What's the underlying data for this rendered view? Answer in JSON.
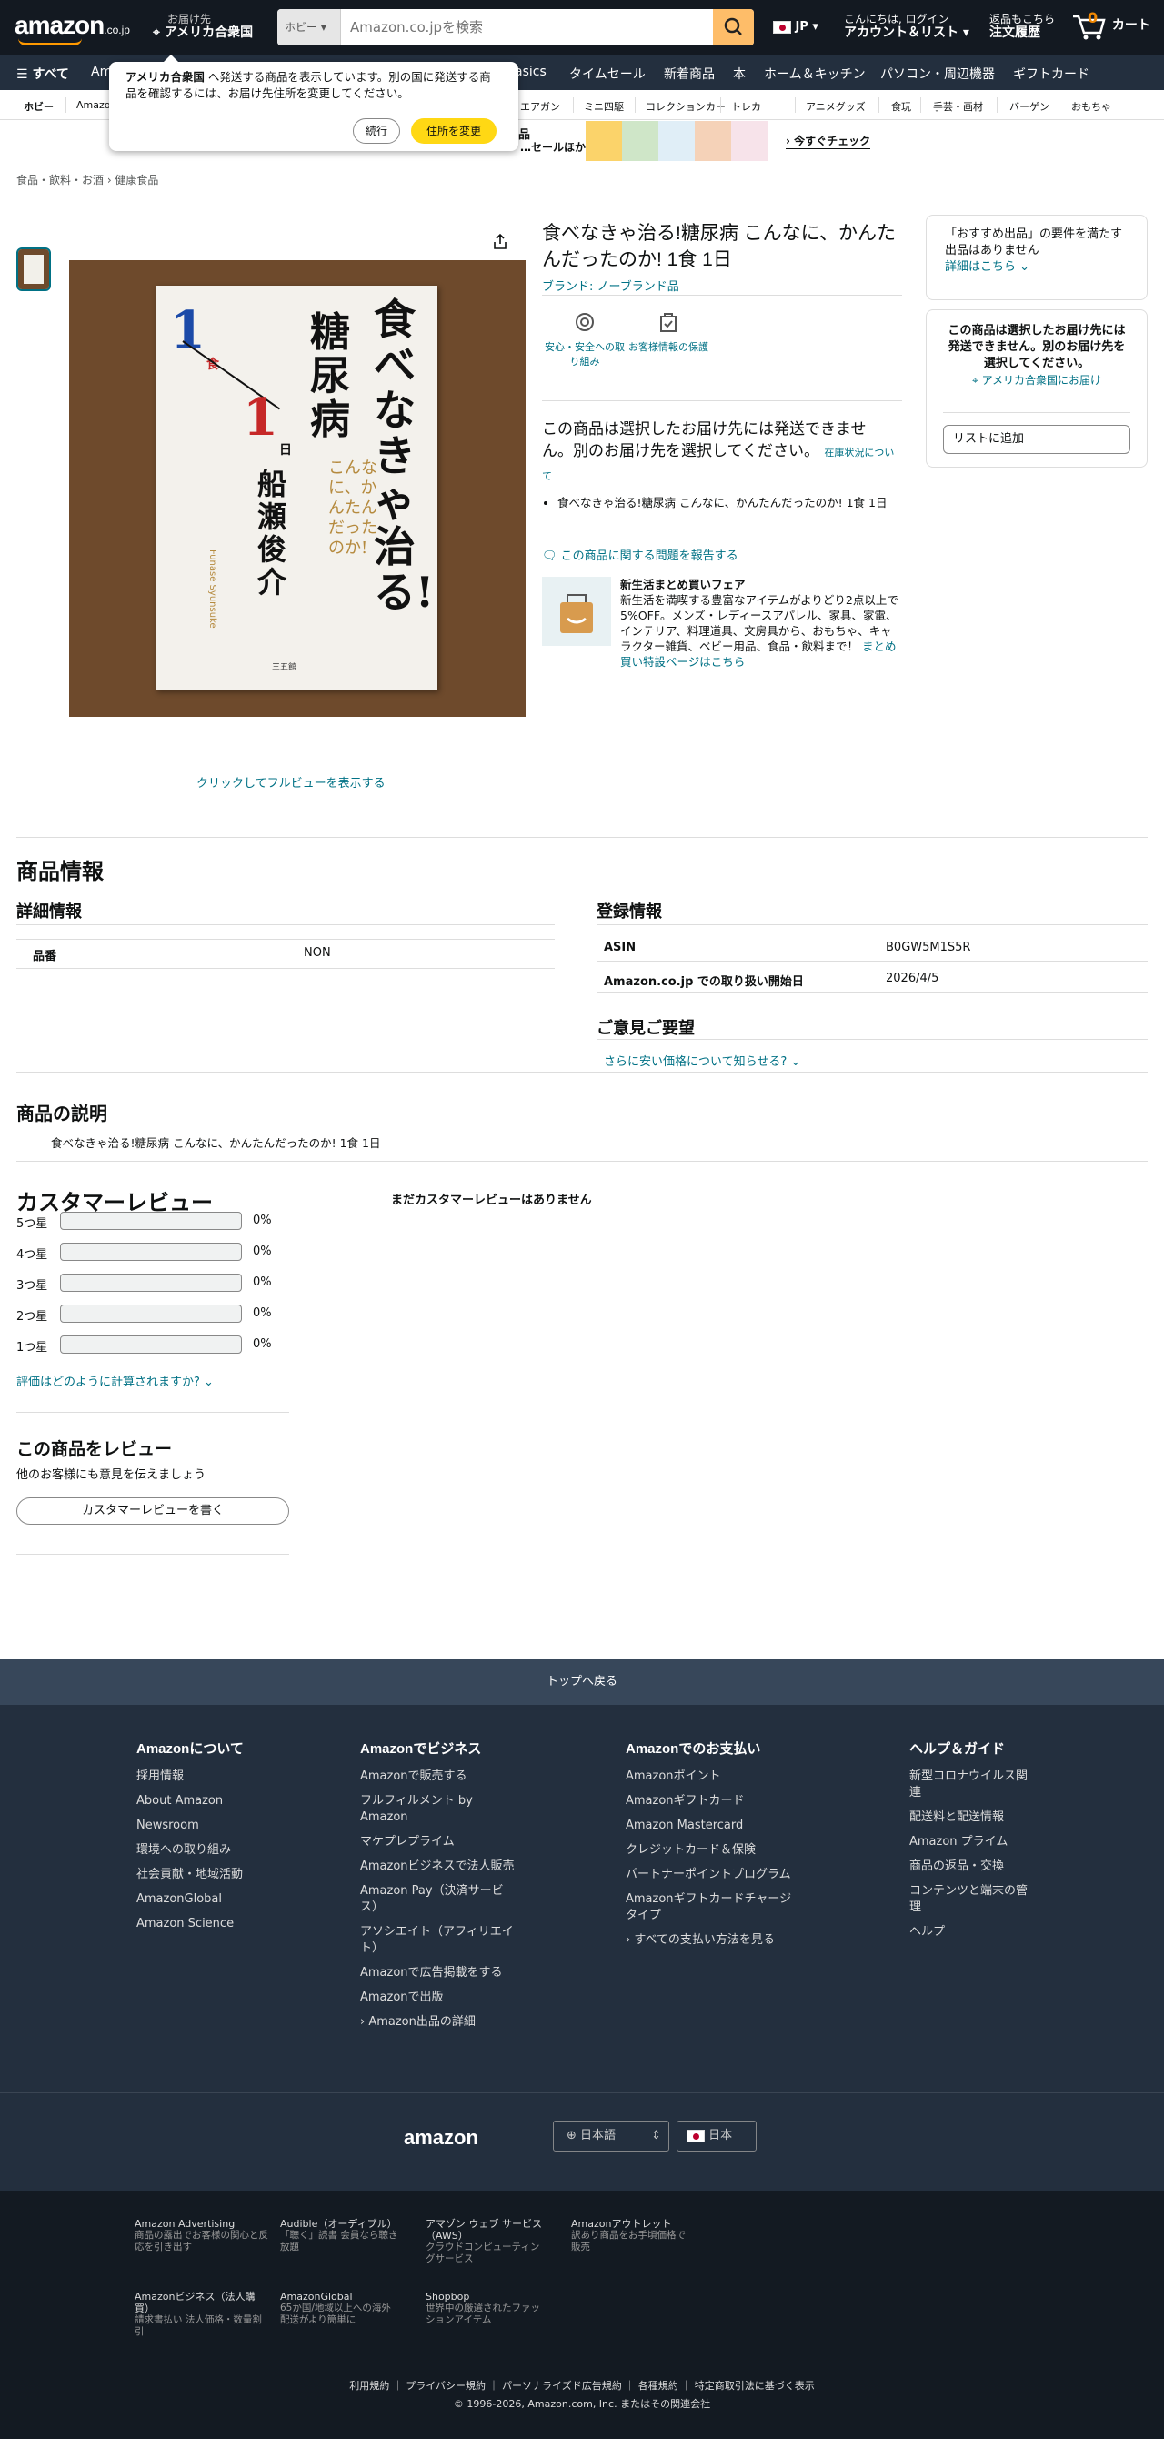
{
  "header": {
    "logo_text": "amazon",
    "logo_suffix": ".co.jp",
    "deliver_line1": "お届け先",
    "deliver_line2": "アメリカ合衆国",
    "search_category": "ホビー",
    "search_placeholder": "Amazon.co.jpを検索",
    "lang": "JP",
    "account_line1": "こんにちは, ログイン",
    "account_line2": "アカウント＆リスト",
    "orders_line1": "返品もこちら",
    "orders_line2": "注文履歴",
    "cart_count": "0",
    "cart_label": "カート"
  },
  "nav": {
    "all": "すべて",
    "items": [
      "Am",
      "asics",
      "タイムセール",
      "新着商品",
      "本",
      "ホーム＆キッチン",
      "パソコン・周辺機器",
      "ギフトカード"
    ]
  },
  "subnav": {
    "items": [
      "ホビー",
      "Amazo",
      "エアガン",
      "ミニ四駆",
      "コレクションカー",
      "トレカ",
      "アニメグッズ",
      "食玩",
      "手芸・画材",
      "バーゲン",
      "おもちゃ"
    ]
  },
  "banner": {
    "text1": "品",
    "text2": "・…セールほか",
    "cta": "今すぐチェック"
  },
  "popup": {
    "text_bold": "アメリカ合衆国",
    "text_rest": " へ発送する商品を表示しています。別の国に発送する商品を確認するには、お届け先住所を変更してください。",
    "continue": "続行",
    "change_address": "住所を変更"
  },
  "breadcrumb": "食品・飲料・お酒 › 健康食品",
  "product": {
    "title": "食べなきゃ治る!糖尿病 こんなに、かんたんだったのか! 1食 1日",
    "brand": "ブランド: ノーブランド品",
    "feature1": "安心・安全への取り組み",
    "feature2": "お客様情報の保護",
    "unavailable": "この商品は選択したお届け先には発送できません。別のお届け先を選択してください。",
    "stock_link": "在庫状況について",
    "bullet": "食べなきゃ治る!糖尿病 こんなに、かんたんだったのか! 1食 1日",
    "report": "この商品に関する問題を報告する",
    "full_view": "クリックしてフルビューを表示する",
    "cover": {
      "main": "食べなきゃ治る!",
      "sub": "糖尿病",
      "tagline": "こんなに、かんたんだったのか!",
      "author": "船瀬俊介",
      "author_roman": "Funase Syunsuke",
      "publisher": "三五館",
      "one_meal": "1",
      "meal_unit": "食",
      "one_day": "1",
      "day_unit": "日"
    }
  },
  "promo": {
    "title": "新生活まとめ買いフェア",
    "body": "新生活を満喫する豊富なアイテムがよりどり2点以上で5%OFF。メンズ・レディースアパレル、家具、家電、インテリア、料理道具、文房具から、おもちゃ、キャラクター雑貨、ベビー用品、食品・飲料まで！",
    "link": "まとめ買い特設ページはこちら"
  },
  "sidebar": {
    "box1_text": "「おすすめ出品」の要件を満たす出品はありません",
    "box1_link": "詳細はこちら",
    "box2_text": "この商品は選択したお届け先には発送できません。別のお届け先を選択してください。",
    "box2_link": "アメリカ合衆国にお届け",
    "add_list": "リストに追加"
  },
  "info": {
    "heading": "商品情報",
    "details_heading": "詳細情報",
    "details": [
      {
        "k": "品番",
        "v": "NON"
      }
    ],
    "reg_heading": "登録情報",
    "reg": [
      {
        "k": "ASIN",
        "v": "B0GW5M1S5R"
      },
      {
        "k": "Amazon.co.jp での取り扱い開始日",
        "v": "2026/4/5"
      }
    ],
    "feedback_heading": "ご意見ご要望",
    "feedback_link": "さらに安い価格について知らせる?"
  },
  "description": {
    "heading": "商品の説明",
    "text": "食べなきゃ治る!糖尿病 こんなに、かんたんだったのか! 1食 1日"
  },
  "reviews": {
    "heading": "カスタマーレビュー",
    "no_reviews": "まだカスタマーレビューはありません",
    "rows": [
      {
        "label": "5つ星",
        "pct": "0%",
        "value": 0
      },
      {
        "label": "4つ星",
        "pct": "0%",
        "value": 0
      },
      {
        "label": "3つ星",
        "pct": "0%",
        "value": 0
      },
      {
        "label": "2つ星",
        "pct": "0%",
        "value": 0
      },
      {
        "label": "1つ星",
        "pct": "0%",
        "value": 0
      }
    ],
    "how_link": "評価はどのように計算されますか?",
    "write_heading": "この商品をレビュー",
    "write_sub": "他のお客様にも意見を伝えましょう",
    "write_btn": "カスタマーレビューを書く"
  },
  "footer": {
    "back_to_top": "トップへ戻る",
    "cols": [
      {
        "title": "Amazonについて",
        "items": [
          "採用情報",
          "About Amazon",
          "Newsroom",
          "環境への取り組み",
          "社会貢献・地域活動",
          "AmazonGlobal",
          "Amazon Science"
        ]
      },
      {
        "title": "Amazonでビジネス",
        "items": [
          "Amazonで販売する",
          "フルフィルメント by Amazon",
          "マケプレプライム",
          "Amazonビジネスで法人販売",
          "Amazon Pay（決済サービス）",
          "アソシエイト（アフィリエイト）",
          "Amazonで広告掲載をする",
          "Amazonで出版",
          "› Amazon出品の詳細"
        ]
      },
      {
        "title": "Amazonでのお支払い",
        "items": [
          "Amazonポイント",
          "Amazonギフトカード",
          "Amazon Mastercard",
          "クレジットカード＆保険",
          "パートナーポイントプログラム",
          "Amazonギフトカードチャージタイプ",
          "› すべての支払い方法を見る"
        ]
      },
      {
        "title": "ヘルプ＆ガイド",
        "items": [
          "新型コロナウイルス関連",
          "配送料と配送情報",
          "Amazon プライム",
          "商品の返品・交換",
          "コンテンツと端末の管理",
          "ヘルプ"
        ]
      }
    ],
    "logo": "amazon",
    "language": "日本語",
    "country": "日本",
    "bottom": [
      {
        "h": "Amazon Advertising",
        "t": "商品の露出でお客様の関心と反応を引き出す"
      },
      {
        "h": "Audible（オーディブル）",
        "t": "「聴く」読書 会員なら聴き放題"
      },
      {
        "h": "アマゾン ウェブ サービス（AWS）",
        "t": "クラウドコンピューティングサービス"
      },
      {
        "h": "Amazonアウトレット",
        "t": "訳あり商品をお手頃価格で販売"
      },
      {
        "h": "Amazonビジネス（法人購買）",
        "t": "請求書払い 法人価格・数量割引"
      },
      {
        "h": "AmazonGlobal",
        "t": "65か国/地域以上への海外配送がより簡単に"
      },
      {
        "h": "Shopbop",
        "t": "世界中の厳選されたファッションアイテム"
      }
    ],
    "legal_links": [
      "利用規約",
      "プライバシー規約",
      "パーソナライズド広告規約",
      "各種規約",
      "特定商取引法に基づく表示"
    ],
    "copyright": "© 1996-2026, Amazon.com, Inc. またはその関連会社"
  }
}
